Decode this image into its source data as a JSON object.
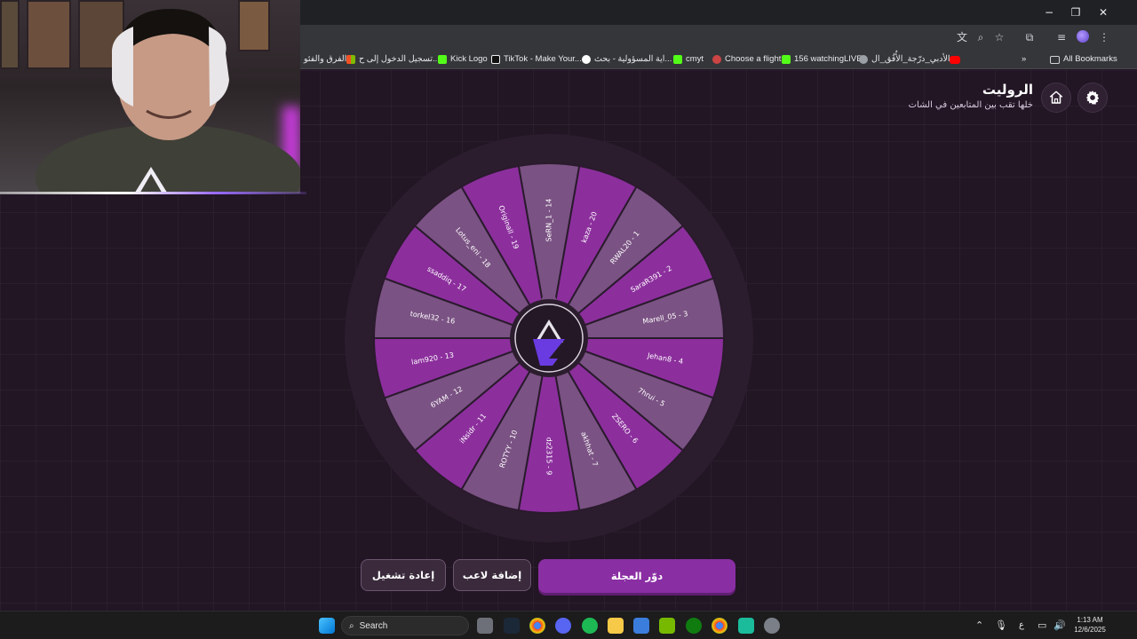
{
  "window": {
    "minimize_glyph": "−",
    "restore_glyph": "❐",
    "close_glyph": "✕"
  },
  "bookmarks": {
    "items": [
      {
        "label": "الفرق والفئو",
        "color": "#4a8bf5"
      },
      {
        "label": "تسجيل الدخول إلى ح...",
        "color": "#f25022"
      },
      {
        "label": "Kick Logo",
        "color": "#53fc18"
      },
      {
        "label": "TikTok - Make Your...",
        "color": "#ffffff"
      },
      {
        "label": "اية المسؤولية - بحث...",
        "color": "#4285f4"
      },
      {
        "label": "cmyt",
        "color": "#53fc18"
      },
      {
        "label": "Choose a flight",
        "color": "#d44"
      },
      {
        "label": "156 watchingLIVE",
        "color": "#53fc18"
      },
      {
        "label": "الأدبي_درّجة_الأُفُق_ال...",
        "color": "#9aa0a6"
      }
    ],
    "all_bookmarks": "All Bookmarks"
  },
  "app": {
    "title": "الروليت",
    "subtitle": "خلها تقب بين المتابعين في الشات"
  },
  "wheel": {
    "entries": [
      "SeRN_1 - 14",
      "kaza - 20",
      "RWAL20 - 1",
      "SaraR391 - 2",
      "Marell_05 - 3",
      "Jehan8 - 4",
      "7hrui - 5",
      "ZSERO - 6",
      "akhhat - 7",
      "dz2315 - 9",
      "ROTYY - 10",
      "iNsidr - 11",
      "6YAM - 12",
      "lam920 - 13",
      "torkel32 - 16",
      "ssaddiq - 17",
      "Lotus_eni - 18",
      "Originall - 19"
    ],
    "colors": {
      "dark": "#8c2f9d",
      "light": "#7a5283"
    }
  },
  "buttons": {
    "spin": "دوّر العجلة",
    "add_player": "إضافة لاعب",
    "reset": "إعادة تشغيل"
  },
  "taskbar": {
    "search_placeholder": "Search",
    "time": "1:13 AM",
    "date": "12/6/2025",
    "lang": "ع"
  }
}
